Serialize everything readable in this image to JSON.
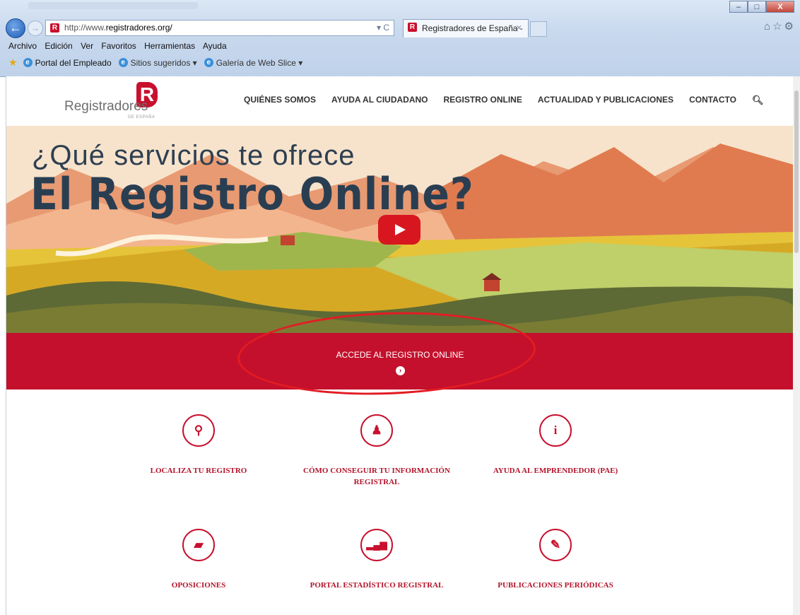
{
  "browser": {
    "address_url_prefix": "http://www.",
    "address_url_domain": "registradores.org/",
    "address_tools": "▾ C",
    "tab_title": "Registradores de España -",
    "menu": [
      "Archivo",
      "Edición",
      "Ver",
      "Favoritos",
      "Herramientas",
      "Ayuda"
    ],
    "favorites": [
      "Portal del Empleado",
      "Sitios sugeridos ▾",
      "Galería de Web Slice ▾"
    ],
    "window_buttons": [
      "–",
      "□",
      "X"
    ]
  },
  "site": {
    "logo_letter": "R",
    "logo_name": "Registradores",
    "logo_sub": "DE ESPAÑA",
    "nav": [
      "QUIÉNES SOMOS",
      "AYUDA AL CIUDADANO",
      "REGISTRO ONLINE",
      "ACTUALIDAD Y PUBLICACIONES",
      "CONTACTO"
    ],
    "hero": {
      "line1": "¿Qué servicios te ofrece",
      "line2": "El Registro Online?"
    },
    "cta_label": "ACCEDE AL REGISTRO ONLINE",
    "services": [
      {
        "icon": "search-icon",
        "glyph": "🔍",
        "label": "LOCALIZA TU REGISTRO"
      },
      {
        "icon": "people-icon",
        "glyph": "👥",
        "label": "CÓMO CONSEGUIR TU INFORMACIÓN REGISTRAL"
      },
      {
        "icon": "info-icon",
        "glyph": "i",
        "label": "AYUDA AL EMPRENDEDOR (PAE)"
      },
      {
        "icon": "book-icon",
        "glyph": "📕",
        "label": "OPOSICIONES"
      },
      {
        "icon": "bar-chart-icon",
        "glyph": "📊",
        "label": "PORTAL ESTADÍSTICO REGISTRAL"
      },
      {
        "icon": "edit-icon",
        "glyph": "✎",
        "label": "PUBLICACIONES PERIÓDICAS"
      }
    ]
  },
  "colors": {
    "brand_red": "#c4102c",
    "navy_text": "#2a3e52",
    "highlight_ring": "#e31c23"
  }
}
